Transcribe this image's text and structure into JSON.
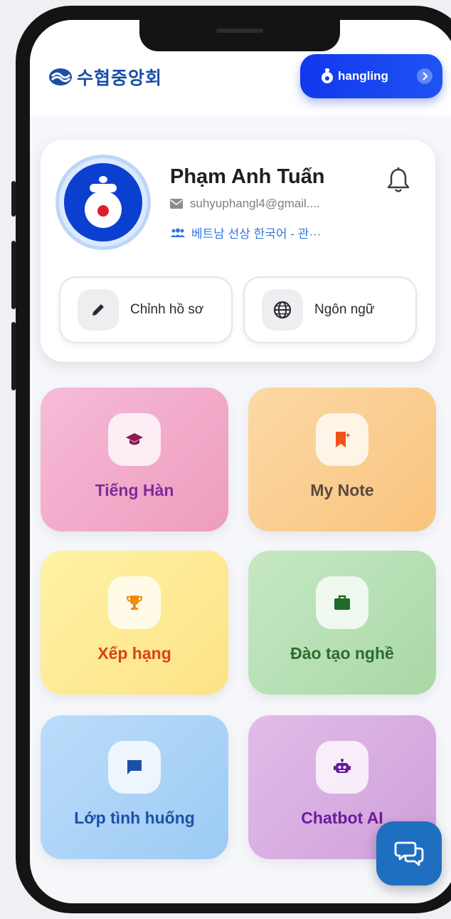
{
  "app": {
    "logo_text": "수협중앙회",
    "brand_button_label": "hangling"
  },
  "profile": {
    "name": "Phạm Anh Tuấn",
    "email": "suhyuphangl4@gmail....",
    "group": "베트남 선상 한국어 - 관···",
    "edit_label": "Chỉnh hồ sơ",
    "language_label": "Ngôn ngữ"
  },
  "menu": [
    {
      "label": "Tiếng Hàn",
      "icon": "graduation-cap-icon",
      "color": "#7a2d9b"
    },
    {
      "label": "My Note",
      "icon": "bookmark-icon",
      "color": "#5a4a3f"
    },
    {
      "label": "Xếp hạng",
      "icon": "trophy-icon",
      "color": "#d84315"
    },
    {
      "label": "Đào tạo nghề",
      "icon": "briefcase-icon",
      "color": "#2e6b2f"
    },
    {
      "label": "Lớp tình huống",
      "icon": "chat-bubble-icon",
      "color": "#1d4fa8"
    },
    {
      "label": "Chatbot AI",
      "icon": "robot-icon",
      "color": "#6a1b9a"
    }
  ],
  "colors": {
    "brand_blue": "#1237ee",
    "logo_blue": "#1b4ea5",
    "fab": "#1e6fc0"
  }
}
